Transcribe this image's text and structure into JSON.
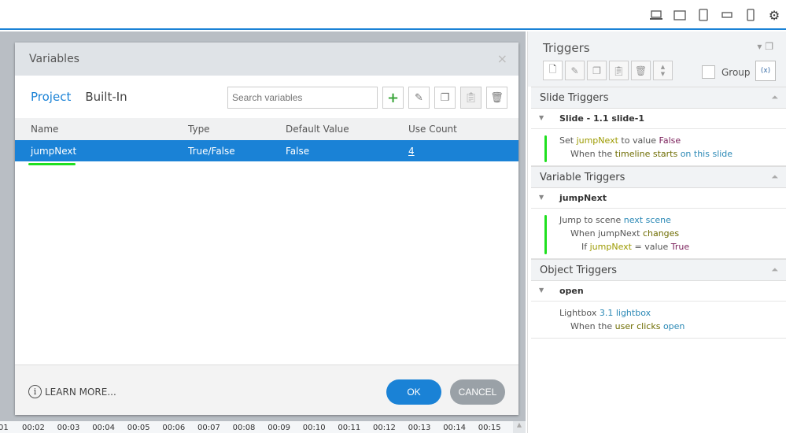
{
  "toolbar": {
    "icons": [
      "laptop-icon",
      "monitor-icon",
      "tablet-portrait-icon",
      "tablet-landscape-icon",
      "phone-icon",
      "gear-icon"
    ]
  },
  "dialog": {
    "title": "Variables",
    "close": "×",
    "tabs": [
      "Project",
      "Built-In"
    ],
    "search_placeholder": "Search variables",
    "columns": [
      "Name",
      "Type",
      "Default Value",
      "Use Count"
    ],
    "rows": [
      {
        "name": "jumpNext",
        "type": "True/False",
        "default": "False",
        "count": "4"
      }
    ],
    "learn_more": "LEARN MORE...",
    "ok": "OK",
    "cancel": "CANCEL"
  },
  "timeline": [
    "01",
    "00:02",
    "00:03",
    "00:04",
    "00:05",
    "00:06",
    "00:07",
    "00:08",
    "00:09",
    "00:10",
    "00:11",
    "00:12",
    "00:13",
    "00:14",
    "00:15"
  ],
  "triggers": {
    "title": "Triggers",
    "group_label": "Group",
    "slide": {
      "header": "Slide Triggers",
      "sub": "Slide - 1.1 slide-1",
      "a1": "Set ",
      "a2": "jumpNext",
      "a3": " to value ",
      "a4": "False",
      "w1": "When the ",
      "w2": "timeline starts",
      "w3": " on this slide"
    },
    "variable": {
      "header": "Variable Triggers",
      "sub": "jumpNext",
      "a1": "Jump to scene ",
      "a2": "next scene",
      "w1": "When jumpNext ",
      "w2": "changes",
      "c1": "If ",
      "c2": "jumpNext",
      "c3": " = value ",
      "c4": "True"
    },
    "object": {
      "header": "Object Triggers",
      "sub": "open",
      "a1": "Lightbox ",
      "a2": "3.1 lightbox",
      "w1": "When the ",
      "w2": "user clicks",
      "w3": " open"
    }
  },
  "colors": {
    "accent": "#1a82d6",
    "highlight": "#1fe01f",
    "variable": "#9c9a00",
    "value": "#7a1f5a",
    "link": "#2a88b5"
  }
}
